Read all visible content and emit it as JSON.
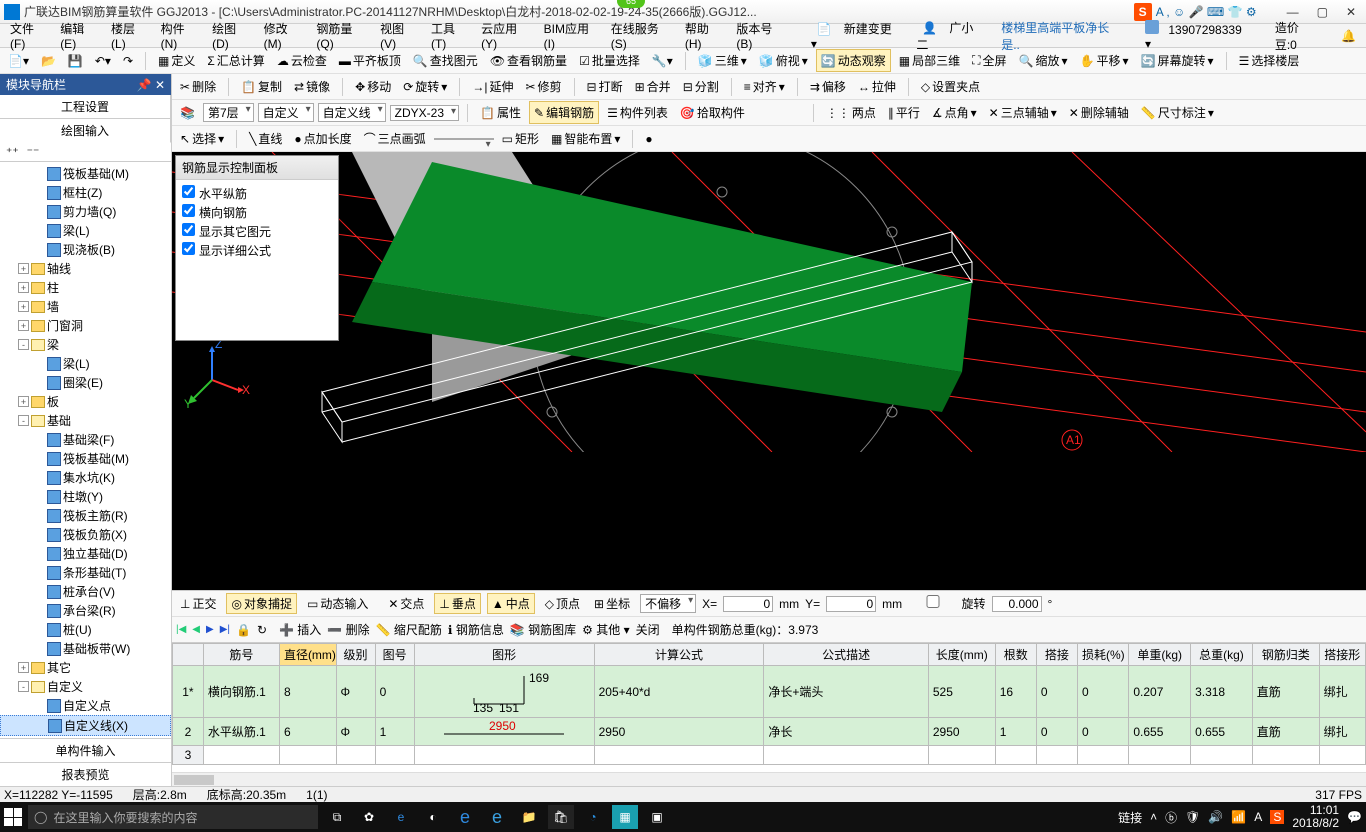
{
  "title": "广联达BIM钢筋算量软件 GGJ2013 - [C:\\Users\\Administrator.PC-20141127NRHM\\Desktop\\白龙村-2018-02-02-19-24-35(2666版).GGJ12...",
  "badge": "65",
  "ime_letter": "S",
  "ime_text": "A , ☺ 🎤 ⌨ 👕 ⚙",
  "win_min": "—",
  "win_max": "▢",
  "win_close": "✕",
  "menu": [
    "文件(F)",
    "编辑(E)",
    "楼层(L)",
    "构件(N)",
    "绘图(D)",
    "修改(M)",
    "钢筋量(Q)",
    "视图(V)",
    "工具(T)",
    "云应用(Y)",
    "BIM应用(I)",
    "在线服务(S)",
    "帮助(H)",
    "版本号(B)"
  ],
  "menu_new_change": "新建变更",
  "menu_user": "广小二",
  "menu_stair": "楼梯里高端平板净长是..",
  "menu_account": "13907298339",
  "menu_credit": "造价豆:0",
  "tb1": {
    "define": "定义",
    "sum": "汇总计算",
    "cloud": "云检查",
    "flat": "平齐板顶",
    "find": "查找图元",
    "view_rebar": "查看钢筋量",
    "batch": "批量选择",
    "threeD": "三维",
    "front": "俯视",
    "dyn": "动态观察",
    "part3d": "局部三维",
    "full": "全屏",
    "zoom": "缩放",
    "pan": "平移",
    "rotate": "屏幕旋转",
    "floor_sel": "选择楼层"
  },
  "tb2": {
    "del": "删除",
    "copy": "复制",
    "mirror": "镜像",
    "move": "移动",
    "rot": "旋转",
    "extend": "延伸",
    "trim": "修剪",
    "break": "打断",
    "merge": "合并",
    "split": "分割",
    "align": "对齐",
    "offset": "偏移",
    "stretch": "拉伸",
    "setpoint": "设置夹点"
  },
  "tb3": {
    "floor": "第7层",
    "custom": "自定义",
    "custom_line": "自定义线",
    "code": "ZDYX-23",
    "attr": "属性",
    "edit_rebar": "编辑钢筋",
    "list": "构件列表",
    "pick": "拾取构件",
    "two_pt": "两点",
    "parallel": "平行",
    "angle": "点角",
    "three_axis": "三点辅轴",
    "del_axis": "删除辅轴",
    "dim": "尺寸标注"
  },
  "tb4": {
    "select": "选择",
    "line": "直线",
    "pt_len": "点加长度",
    "three_arc": "三点画弧",
    "rect": "矩形",
    "smart": "智能布置"
  },
  "nav": {
    "header": "模块导航栏",
    "tab1": "工程设置",
    "tab2": "绘图输入"
  },
  "tree": [
    {
      "lv": 2,
      "icon": "leaf",
      "label": "筏板基础(M)"
    },
    {
      "lv": 2,
      "icon": "leaf",
      "label": "框柱(Z)"
    },
    {
      "lv": 2,
      "icon": "leaf",
      "label": "剪力墙(Q)"
    },
    {
      "lv": 2,
      "icon": "leaf",
      "label": "梁(L)"
    },
    {
      "lv": 2,
      "icon": "leaf",
      "label": "现浇板(B)"
    },
    {
      "lv": 1,
      "toggle": "+",
      "icon": "folder",
      "label": "轴线"
    },
    {
      "lv": 1,
      "toggle": "+",
      "icon": "folder",
      "label": "柱"
    },
    {
      "lv": 1,
      "toggle": "+",
      "icon": "folder",
      "label": "墙"
    },
    {
      "lv": 1,
      "toggle": "+",
      "icon": "folder",
      "label": "门窗洞"
    },
    {
      "lv": 1,
      "toggle": "-",
      "icon": "folder-open",
      "label": "梁"
    },
    {
      "lv": 2,
      "icon": "leaf",
      "label": "梁(L)"
    },
    {
      "lv": 2,
      "icon": "leaf",
      "label": "圈梁(E)"
    },
    {
      "lv": 1,
      "toggle": "+",
      "icon": "folder",
      "label": "板"
    },
    {
      "lv": 1,
      "toggle": "-",
      "icon": "folder-open",
      "label": "基础"
    },
    {
      "lv": 2,
      "icon": "leaf",
      "label": "基础梁(F)"
    },
    {
      "lv": 2,
      "icon": "leaf",
      "label": "筏板基础(M)"
    },
    {
      "lv": 2,
      "icon": "leaf",
      "label": "集水坑(K)"
    },
    {
      "lv": 2,
      "icon": "leaf",
      "label": "柱墩(Y)"
    },
    {
      "lv": 2,
      "icon": "leaf",
      "label": "筏板主筋(R)"
    },
    {
      "lv": 2,
      "icon": "leaf",
      "label": "筏板负筋(X)"
    },
    {
      "lv": 2,
      "icon": "leaf",
      "label": "独立基础(D)"
    },
    {
      "lv": 2,
      "icon": "leaf",
      "label": "条形基础(T)"
    },
    {
      "lv": 2,
      "icon": "leaf",
      "label": "桩承台(V)"
    },
    {
      "lv": 2,
      "icon": "leaf",
      "label": "承台梁(R)"
    },
    {
      "lv": 2,
      "icon": "leaf",
      "label": "桩(U)"
    },
    {
      "lv": 2,
      "icon": "leaf",
      "label": "基础板带(W)"
    },
    {
      "lv": 1,
      "toggle": "+",
      "icon": "folder",
      "label": "其它"
    },
    {
      "lv": 1,
      "toggle": "-",
      "icon": "folder-open",
      "label": "自定义"
    },
    {
      "lv": 2,
      "icon": "leaf",
      "label": "自定义点"
    },
    {
      "lv": 2,
      "icon": "leaf",
      "label": "自定义线(X)",
      "selected": true
    }
  ],
  "bottom_tabs": [
    "单构件输入",
    "报表预览"
  ],
  "float": {
    "title": "钢筋显示控制面板",
    "items": [
      "水平纵筋",
      "横向钢筋",
      "显示其它图元",
      "显示详细公式"
    ]
  },
  "snap": {
    "ortho": "正交",
    "obj": "对象捕捉",
    "dyn": "动态输入",
    "cross": "交点",
    "perp": "垂点",
    "mid": "中点",
    "vertex": "顶点",
    "coord": "坐标",
    "no_offset": "不偏移",
    "x": "0",
    "y": "0",
    "rot": "旋转",
    "rot_val": "0.000"
  },
  "rebar_bar": {
    "insert": "插入",
    "del": "删除",
    "scale": "缩尺配筋",
    "info": "钢筋信息",
    "lib": "钢筋图库",
    "other": "其他",
    "close": "关闭",
    "total_label": "单构件钢筋总重(kg)：",
    "total": "3.973"
  },
  "table": {
    "headers": [
      "",
      "筋号",
      "直径(mm)",
      "级别",
      "图号",
      "图形",
      "计算公式",
      "公式描述",
      "长度(mm)",
      "根数",
      "搭接",
      "损耗(%)",
      "单重(kg)",
      "总重(kg)",
      "钢筋归类",
      "搭接形"
    ],
    "rows": [
      {
        "idx": "1*",
        "name": "横向钢筋.1",
        "dia": "8",
        "grade": "Φ",
        "fig": "0",
        "shape_nums": [
          "169",
          "135",
          "151"
        ],
        "formula": "205+40*d",
        "desc": "净长+端头",
        "len": "525",
        "count": "16",
        "lap": "0",
        "loss": "0",
        "uw": "0.207",
        "tw": "3.318",
        "cat": "直筋",
        "lap2": "绑扎"
      },
      {
        "idx": "2",
        "name": "水平纵筋.1",
        "dia": "6",
        "grade": "Φ",
        "fig": "1",
        "shape_len": "2950",
        "formula": "2950",
        "desc": "净长",
        "len": "2950",
        "count": "1",
        "lap": "0",
        "loss": "0",
        "uw": "0.655",
        "tw": "0.655",
        "cat": "直筋",
        "lap2": "绑扎"
      },
      {
        "idx": "3"
      }
    ]
  },
  "status": {
    "xy": "X=112282 Y=-11595",
    "floor_h": "层高:2.8m",
    "bottom": "底标高:20.35m",
    "sel": "1(1)",
    "fps": "317 FPS"
  },
  "taskbar": {
    "search": "在这里输入你要搜索的内容",
    "link": "链接",
    "time": "11:01",
    "date": "2018/8/2"
  },
  "axis_label": "A1"
}
